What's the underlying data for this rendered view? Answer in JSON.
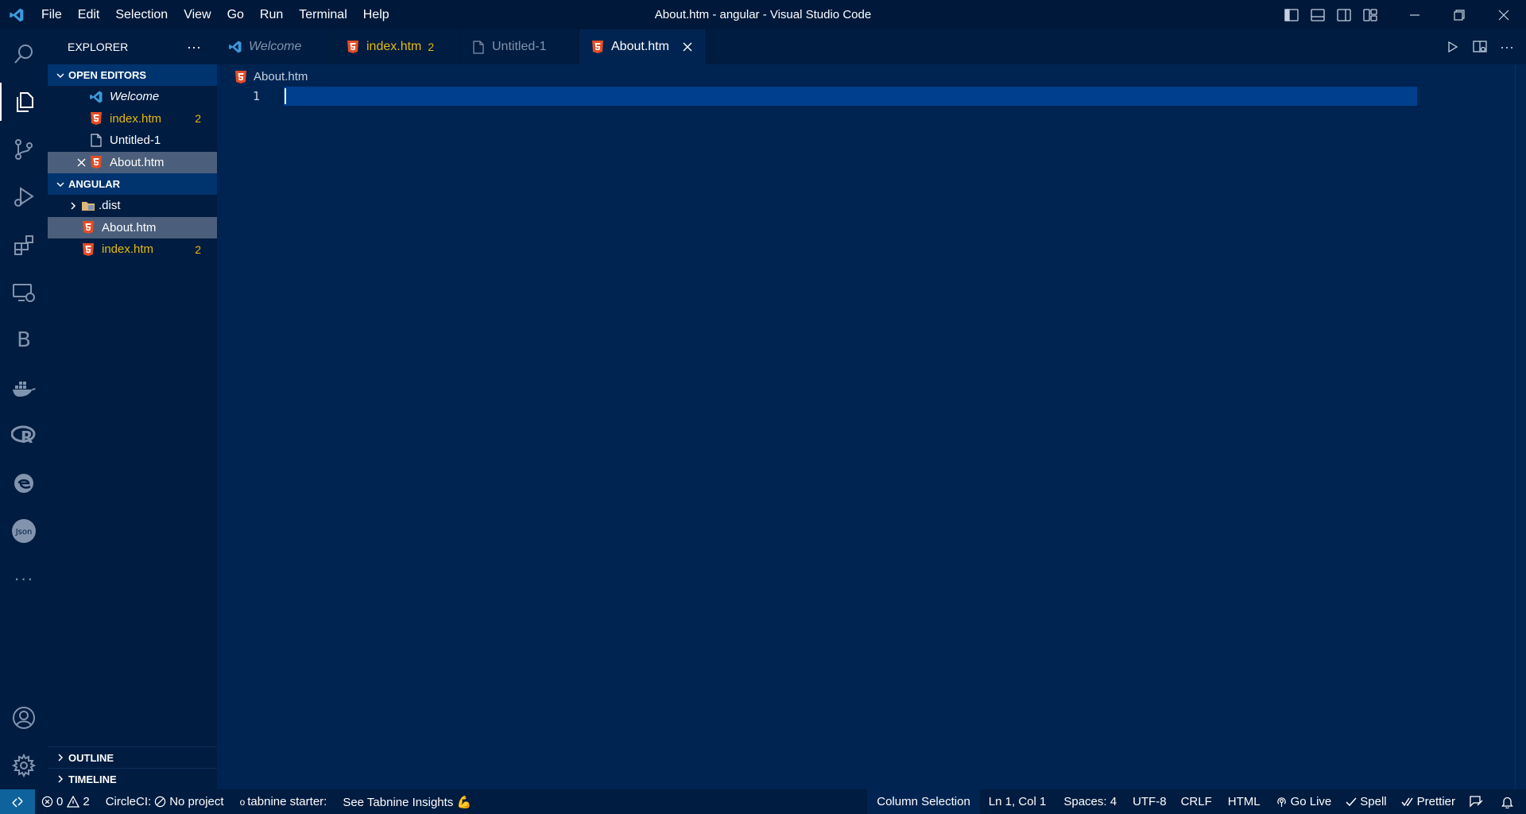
{
  "window": {
    "title": "About.htm - angular - Visual Studio Code"
  },
  "menu": [
    "File",
    "Edit",
    "Selection",
    "View",
    "Go",
    "Run",
    "Terminal",
    "Help"
  ],
  "activity_bar": {
    "items": [
      "search-icon",
      "explorer-icon",
      "source-control-icon",
      "run-debug-icon",
      "extensions-icon",
      "remote-explorer-icon",
      "bookmarks-icon",
      "docker-icon",
      "r-icon",
      "edge-icon",
      "json-icon",
      "more-icon"
    ],
    "bookmarks_letter": "B",
    "json_label": "Json",
    "more_label": "···"
  },
  "sidebar": {
    "title": "EXPLORER",
    "more_label": "···",
    "open_editors": {
      "label": "OPEN EDITORS",
      "items": [
        {
          "label": "Welcome",
          "badge": ""
        },
        {
          "label": "index.htm",
          "badge": "2"
        },
        {
          "label": "Untitled-1",
          "badge": ""
        },
        {
          "label": "About.htm",
          "badge": ""
        }
      ]
    },
    "folder": {
      "label": "ANGULAR",
      "items": [
        {
          "label": ".dist",
          "badge": ""
        },
        {
          "label": "About.htm",
          "badge": ""
        },
        {
          "label": "index.htm",
          "badge": "2"
        }
      ]
    },
    "outline_label": "OUTLINE",
    "timeline_label": "TIMELINE"
  },
  "tabs": [
    {
      "label": "Welcome",
      "badge": ""
    },
    {
      "label": "index.htm",
      "badge": "2"
    },
    {
      "label": "Untitled-1",
      "badge": ""
    },
    {
      "label": "About.htm",
      "badge": ""
    }
  ],
  "editor": {
    "breadcrumb": "About.htm",
    "line_number": "1"
  },
  "statusbar": {
    "errors": "0",
    "warnings": "2",
    "circleci": "CircleCI:",
    "no_project": "No project",
    "tabnine": "tabnine starter:",
    "tabnine_prefix": "o",
    "insights": "See Tabnine Insights 💪",
    "column_selection": "Column Selection",
    "position": "Ln 1, Col 1",
    "spaces": "Spaces: 4",
    "encoding": "UTF-8",
    "eol": "CRLF",
    "language": "HTML",
    "go_live": "Go Live",
    "spell": "Spell",
    "prettier": "Prettier"
  },
  "colors": {
    "background": "#002451",
    "sidebar": "#001c40",
    "modified": "#e5b80f",
    "html_icon": "#e44d26",
    "vscode_blue": "#3c99dc"
  }
}
